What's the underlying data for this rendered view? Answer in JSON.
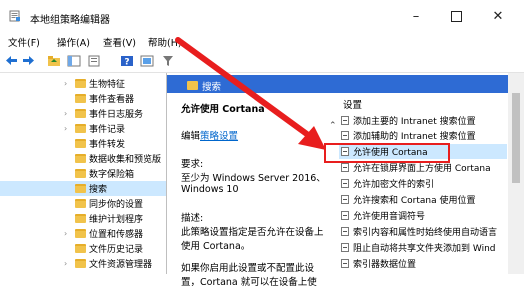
{
  "window": {
    "title": "本地组策略编辑器"
  },
  "menu": [
    {
      "label": "文件(F)"
    },
    {
      "label": "操作(A)"
    },
    {
      "label": "查看(V)"
    },
    {
      "label": "帮助(H)"
    }
  ],
  "tree": {
    "items": [
      {
        "label": "生物特征"
      },
      {
        "label": "事件查看器"
      },
      {
        "label": "事件日志服务"
      },
      {
        "label": "事件记录"
      },
      {
        "label": "事件转发"
      },
      {
        "label": "数据收集和预览版"
      },
      {
        "label": "数字保险箱"
      },
      {
        "label": "搜索"
      },
      {
        "label": "同步你的设置"
      },
      {
        "label": "维护计划程序"
      },
      {
        "label": "位置和传感器"
      },
      {
        "label": "文件历史记录"
      },
      {
        "label": "文件资源管理器"
      }
    ]
  },
  "header": {
    "text": "搜索"
  },
  "detail": {
    "title": "允许使用 Cortana",
    "edit_prefix": "编辑",
    "edit_link": "策略设置",
    "req_label": "要求:",
    "req_line1": "至少为 Windows Server 2016、",
    "req_line2": "Windows 10",
    "desc_label": "描述:",
    "desc_line1": "此策略设置指定是否允许在设备上",
    "desc_line2": "使用 Cortana。",
    "desc_line3": "如果你启用此设置或不配置此设",
    "desc_line4": "置，Cortana 就可以在设备上使"
  },
  "settings": {
    "column_header": "设置",
    "items": [
      {
        "label": "添加主要的 Intranet 搜索位置"
      },
      {
        "label": "添加辅助的 Intranet 搜索位置"
      },
      {
        "label": "允许使用 Cortana"
      },
      {
        "label": "允许在锁屏界面上方使用 Cortana"
      },
      {
        "label": "允许加密文件的索引"
      },
      {
        "label": "允许搜索和 Cortana 使用位置"
      },
      {
        "label": "允许使用音调符号"
      },
      {
        "label": "索引内容和属性时始终使用自动语言"
      },
      {
        "label": "阻止自动将共享文件夹添加到 Wind"
      },
      {
        "label": "索引器数据位置"
      }
    ]
  },
  "colors": {
    "header_blue": "#2e6bd4",
    "annotation_red": "#e81e1e",
    "selection": "#cce8ff"
  }
}
